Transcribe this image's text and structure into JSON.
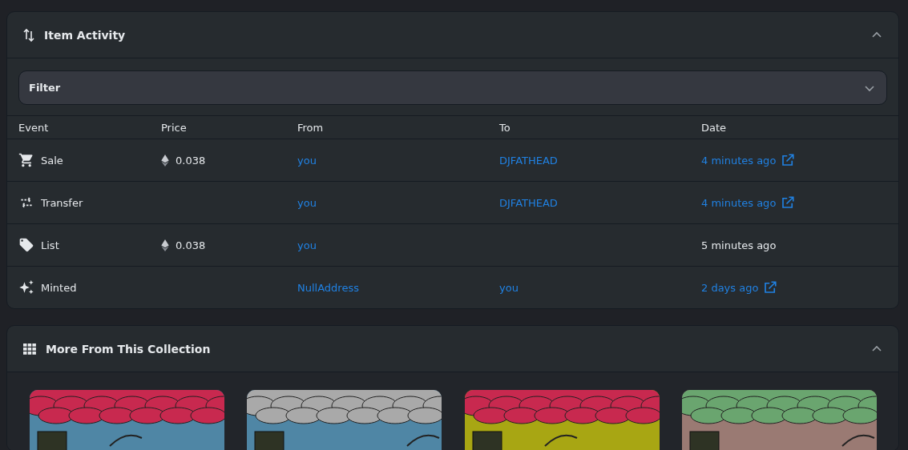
{
  "activity": {
    "title": "Item Activity",
    "expanded": true,
    "filter": {
      "label": "Filter"
    },
    "columns": [
      "Event",
      "Price",
      "From",
      "To",
      "Date"
    ],
    "rows": [
      {
        "kind": "sale",
        "event": "Sale",
        "price": "0.038",
        "from": "you",
        "to": "DJFATHEAD",
        "date": "4 minutes ago",
        "linked": true
      },
      {
        "kind": "transfer",
        "event": "Transfer",
        "from": "you",
        "to": "DJFATHEAD",
        "date": "4 minutes ago",
        "linked": true
      },
      {
        "kind": "list",
        "event": "List",
        "price": "0.038",
        "from": "you",
        "date": "5 minutes ago",
        "linked": false
      },
      {
        "kind": "minted",
        "event": "Minted",
        "from": "NullAddress",
        "to": "you",
        "date": "2 days ago",
        "linked": true
      }
    ]
  },
  "collection": {
    "title": "More From This Collection",
    "expanded": true
  }
}
